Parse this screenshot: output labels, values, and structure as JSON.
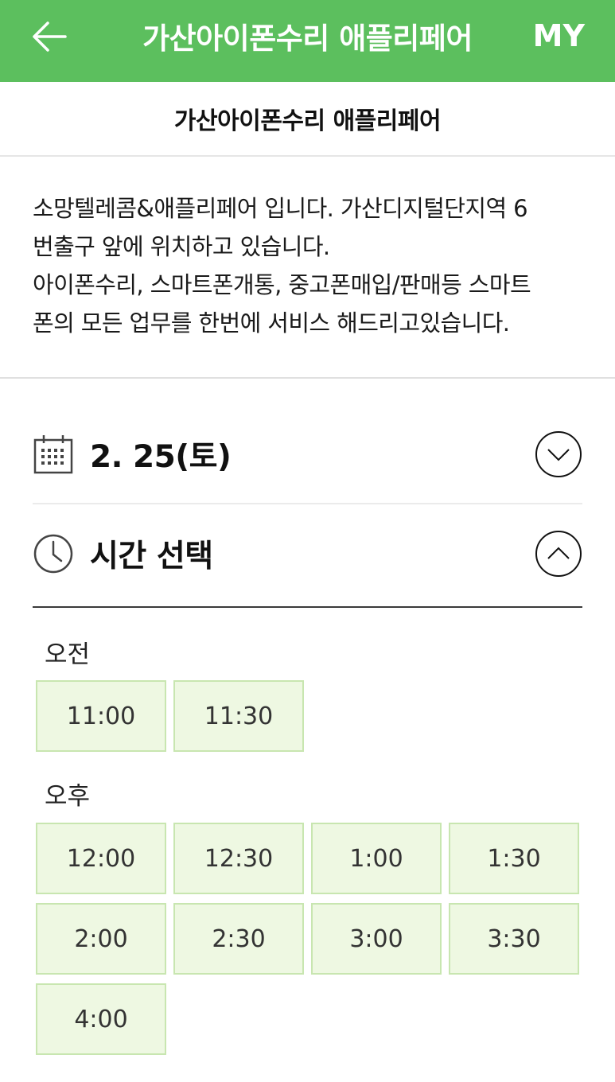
{
  "header": {
    "back_icon": "arrow-left-icon",
    "title": "가산아이폰수리 애플리페어",
    "my_label": "MY",
    "accent_color": "#5cbf5e"
  },
  "store": {
    "name": "가산아이폰수리 애플리페어",
    "description_lines": [
      "소망텔레콤&애플리페어 입니다. 가산디지털단지역 6",
      "번출구 앞에 위치하고 있습니다.",
      "아이폰수리, 스마트폰개통, 중고폰매입/판매등 스마트",
      "폰의 모든 업무를 한번에 서비스 해드리고있습니다."
    ]
  },
  "date_section": {
    "icon": "calendar-icon",
    "label": "2. 25(토)",
    "toggle_icon": "chevron-down-circle-icon"
  },
  "time_section": {
    "icon": "clock-icon",
    "label": "시간 선택",
    "toggle_icon": "chevron-up-circle-icon",
    "am_label": "오전",
    "am_slots": [
      "11:00",
      "11:30"
    ],
    "pm_label": "오후",
    "pm_slots": [
      "12:00",
      "12:30",
      "1:00",
      "1:30",
      "2:00",
      "2:30",
      "3:00",
      "3:30",
      "4:00"
    ],
    "slot_bg": "#eef8e2",
    "slot_border": "#c8e6b0"
  }
}
